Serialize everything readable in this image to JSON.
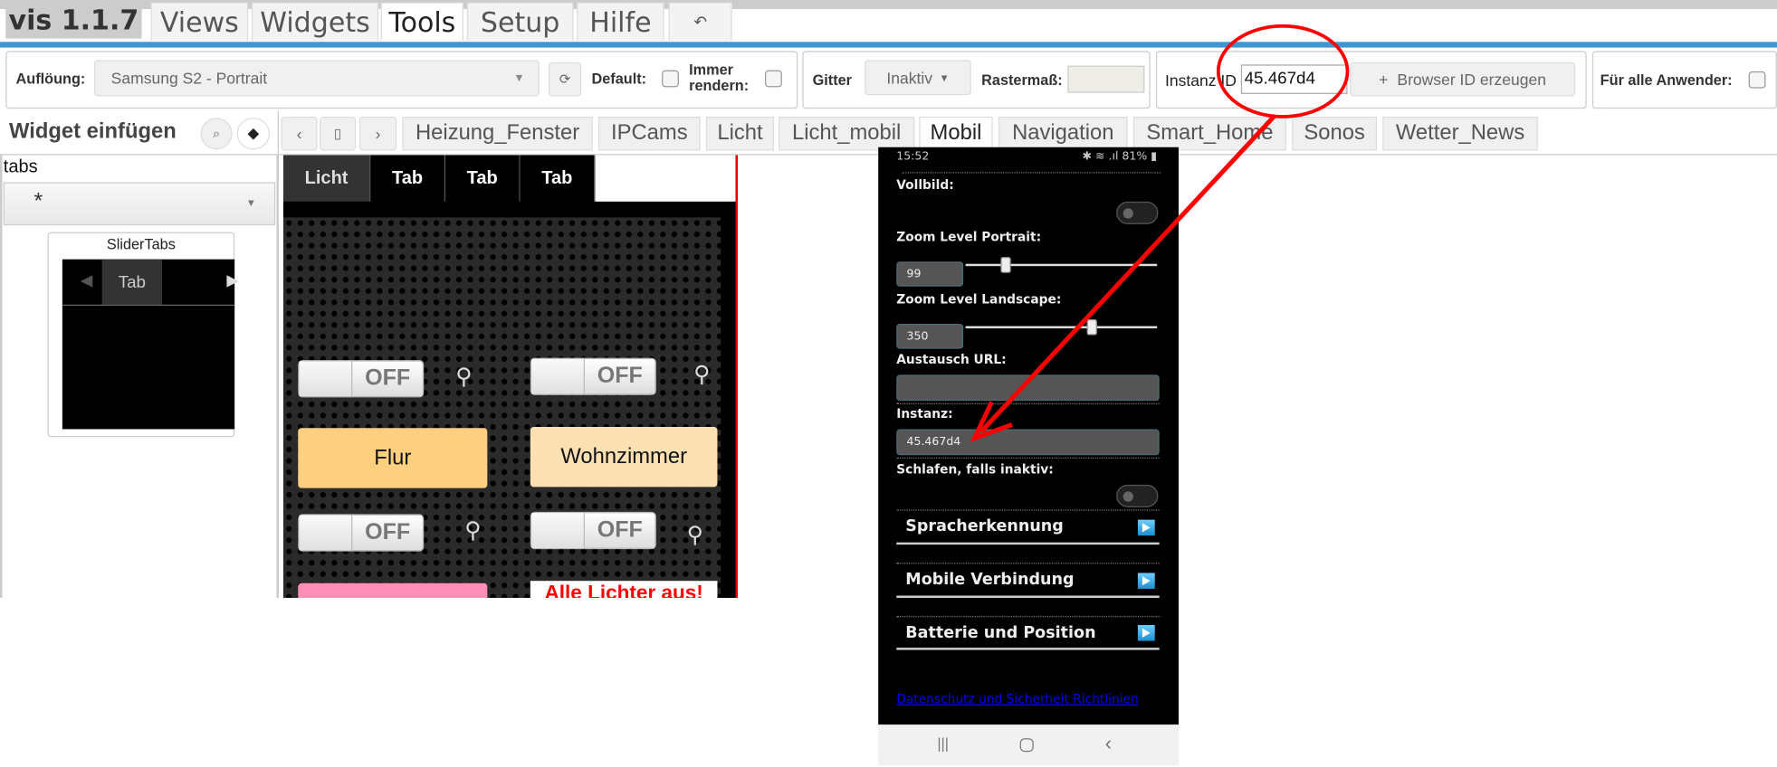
{
  "app": {
    "version_label": "vis 1.1.7"
  },
  "main_tabs": [
    {
      "label": "Views"
    },
    {
      "label": "Widgets"
    },
    {
      "label": "Tools",
      "active": true
    },
    {
      "label": "Setup"
    },
    {
      "label": "Hilfe"
    }
  ],
  "undo_icon": "undo-icon",
  "toolbar": {
    "resolution_label": "Auflöung:",
    "resolution_value": "Samsung S2 - Portrait",
    "default_label": "Default:",
    "always_render_label_1": "Immer",
    "always_render_label_2": "rendern:",
    "grid_label": "Gitter",
    "grid_value": "Inaktiv",
    "raster_label": "Rastermaß:",
    "raster_value": "",
    "instance_label": "Instanz ID",
    "instance_value": "45.467d4",
    "browser_id_button": "Browser ID erzeugen",
    "all_users_label": "Für alle Anwender:"
  },
  "widget_panel": {
    "title": "Widget einfügen",
    "filter_value": "tabs",
    "set_value": "*",
    "widget_title": "SliderTabs",
    "widget_tab_label": "Tab"
  },
  "view_tabs": [
    {
      "label": "Heizung_Fenster"
    },
    {
      "label": "IPCams"
    },
    {
      "label": "Licht"
    },
    {
      "label": "Licht_mobil"
    },
    {
      "label": "Mobil",
      "active": true
    },
    {
      "label": "Navigation"
    },
    {
      "label": "Smart_Home"
    },
    {
      "label": "Sonos"
    },
    {
      "label": "Wetter_News"
    }
  ],
  "canvas": {
    "tabs": [
      {
        "label": "Licht"
      },
      {
        "label": "Tab"
      },
      {
        "label": "Tab"
      },
      {
        "label": "Tab"
      }
    ],
    "switch_label": "OFF",
    "buttons": {
      "flur": "Flur",
      "wohnzimmer": "Wohnzimmer",
      "all_off": "Alle Lichter aus!"
    },
    "colors": {
      "flur": "#ffd080",
      "wohnzimmer": "#fde1b3",
      "pink": "#ff8db5"
    }
  },
  "phone": {
    "time": "15:52",
    "battery": "81%",
    "vollbild_label": "Vollbild:",
    "zoom_portrait_label": "Zoom Level Portrait:",
    "zoom_portrait_value": "99",
    "zoom_landscape_label": "Zoom Level Landscape:",
    "zoom_landscape_value": "350",
    "url_label": "Austausch URL:",
    "url_value": "",
    "instance_label": "Instanz:",
    "instance_value": "45.467d4",
    "sleep_label": "Schlafen, falls inaktiv:",
    "menu": [
      {
        "label": "Spracherkennung"
      },
      {
        "label": "Mobile Verbindung"
      },
      {
        "label": "Batterie und Position"
      }
    ],
    "privacy_link": "Datenschutz und Sicherheit Richtlinien"
  },
  "annotation_color": "#ff0000"
}
